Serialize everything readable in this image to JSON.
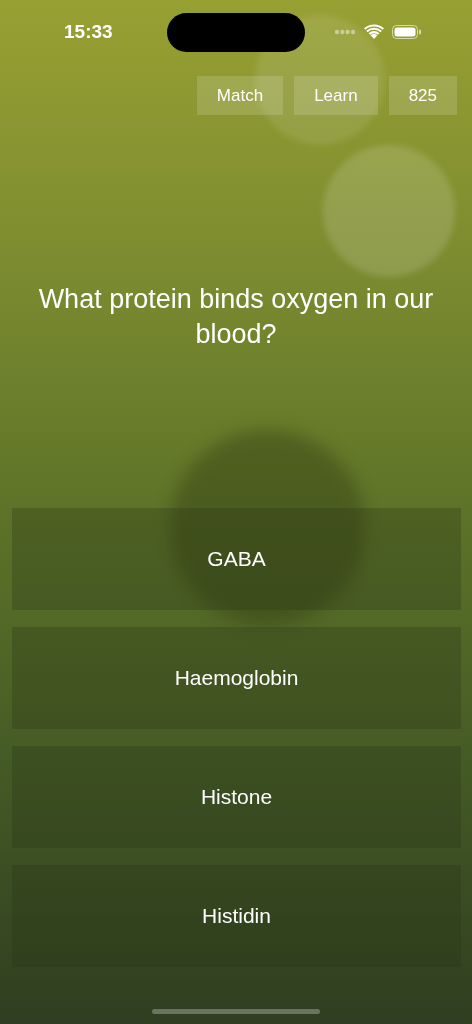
{
  "status_bar": {
    "time": "15:33"
  },
  "top_buttons": [
    {
      "label": "Match"
    },
    {
      "label": "Learn"
    },
    {
      "label": "825"
    }
  ],
  "question": "What protein binds oxygen in our blood?",
  "answers": [
    {
      "label": "GABA"
    },
    {
      "label": "Haemoglobin"
    },
    {
      "label": "Histone"
    },
    {
      "label": "Histidin"
    }
  ]
}
